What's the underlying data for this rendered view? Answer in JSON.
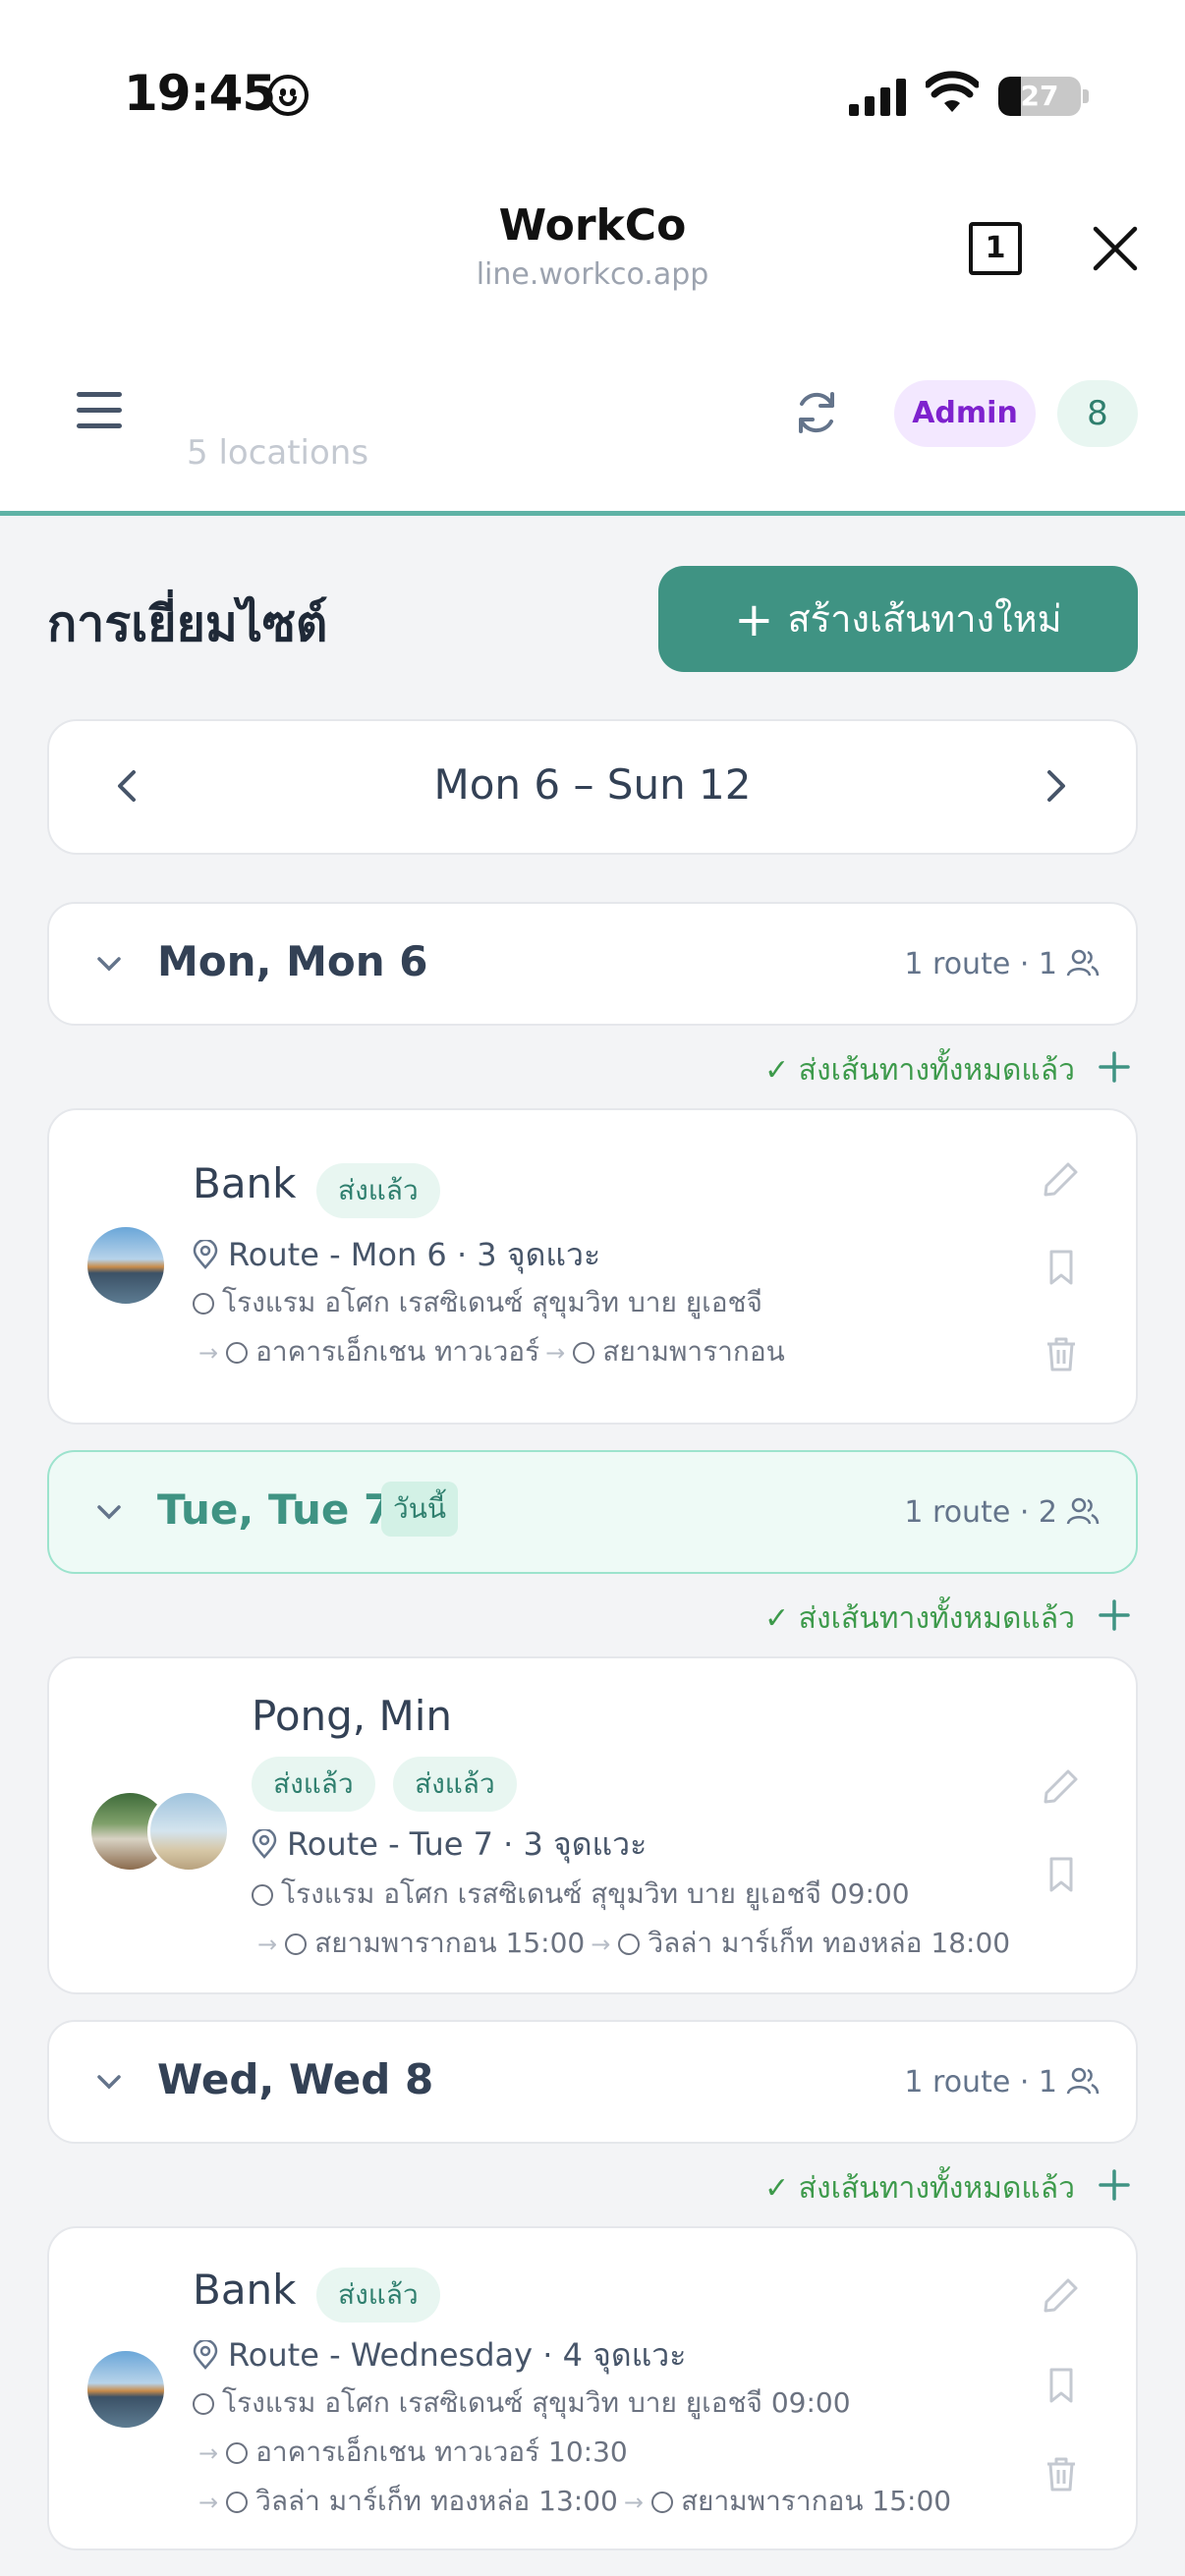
{
  "status_bar": {
    "time": "19:45",
    "battery": "27",
    "battery_level": 0.27
  },
  "browser": {
    "title": "WorkCo",
    "url": "line.workco.app",
    "tab_count": "1"
  },
  "app_header": {
    "peek_text": "5 locations",
    "role_badge": "Admin",
    "count_badge": "8"
  },
  "page": {
    "title": "การเยี่ยมไซต์",
    "new_route_button": "สร้างเส้นทางใหม่"
  },
  "week_nav": {
    "label": "Mon 6 – Sun 12"
  },
  "days": [
    {
      "title": "Mon, Mon 6",
      "meta": "1 route · 1",
      "is_today": false,
      "sent_all": "✓ ส่งเส้นทางทั้งหมดแล้ว",
      "routes": [
        {
          "name": "Bank",
          "statuses": [
            "ส่งแล้ว"
          ],
          "route": "Route - Mon 6 · 3 จุดแวะ",
          "stops_lines": [
            [
              "โรงแรม อโศก เรสซิเดนซ์ สุขุมวิท บาย ยูเอชจี"
            ],
            [
              "อาคารเอ็กเชน ทาวเวอร์",
              "สยามพารากอน"
            ]
          ]
        }
      ]
    },
    {
      "title": "Tue, Tue 7",
      "today_label": "วันนี้",
      "meta": "1 route · 2",
      "is_today": true,
      "sent_all": "✓ ส่งเส้นทางทั้งหมดแล้ว",
      "routes": [
        {
          "name": "Pong, Min",
          "statuses": [
            "ส่งแล้ว",
            "ส่งแล้ว"
          ],
          "route": "Route - Tue 7 · 3 จุดแวะ",
          "stops_lines": [
            [
              "โรงแรม อโศก เรสซิเดนซ์ สุขุมวิท บาย ยูเอชจี 09:00"
            ],
            [
              "สยามพารากอน 15:00",
              "วิลล่า มาร์เก็ท ทองหล่อ 18:00"
            ]
          ]
        }
      ]
    },
    {
      "title": "Wed, Wed 8",
      "meta": "1 route · 1",
      "is_today": false,
      "sent_all": "✓ ส่งเส้นทางทั้งหมดแล้ว",
      "routes": [
        {
          "name": "Bank",
          "statuses": [
            "ส่งแล้ว"
          ],
          "route": "Route - Wednesday · 4 จุดแวะ",
          "stops_lines": [
            [
              "โรงแรม อโศก เรสซิเดนซ์ สุขุมวิท บาย ยูเอชจี 09:00"
            ],
            [
              "อาคารเอ็กเชน ทาวเวอร์ 10:30"
            ],
            [
              "วิลล่า มาร์เก็ท ทองหล่อ 13:00",
              "สยามพารากอน 15:00"
            ]
          ]
        }
      ]
    }
  ],
  "colors": {
    "accent": "#3f9383",
    "sent_green": "#3d9a4b",
    "admin_purple": "#7e22ce",
    "divider_teal": "#5fb3a6"
  },
  "icons": {
    "menu": "menu-icon",
    "refresh": "refresh-icon",
    "edit": "pencil-icon",
    "bookmark": "bookmark-icon",
    "delete": "trash-icon",
    "people": "people-icon",
    "pin": "map-pin-icon"
  }
}
